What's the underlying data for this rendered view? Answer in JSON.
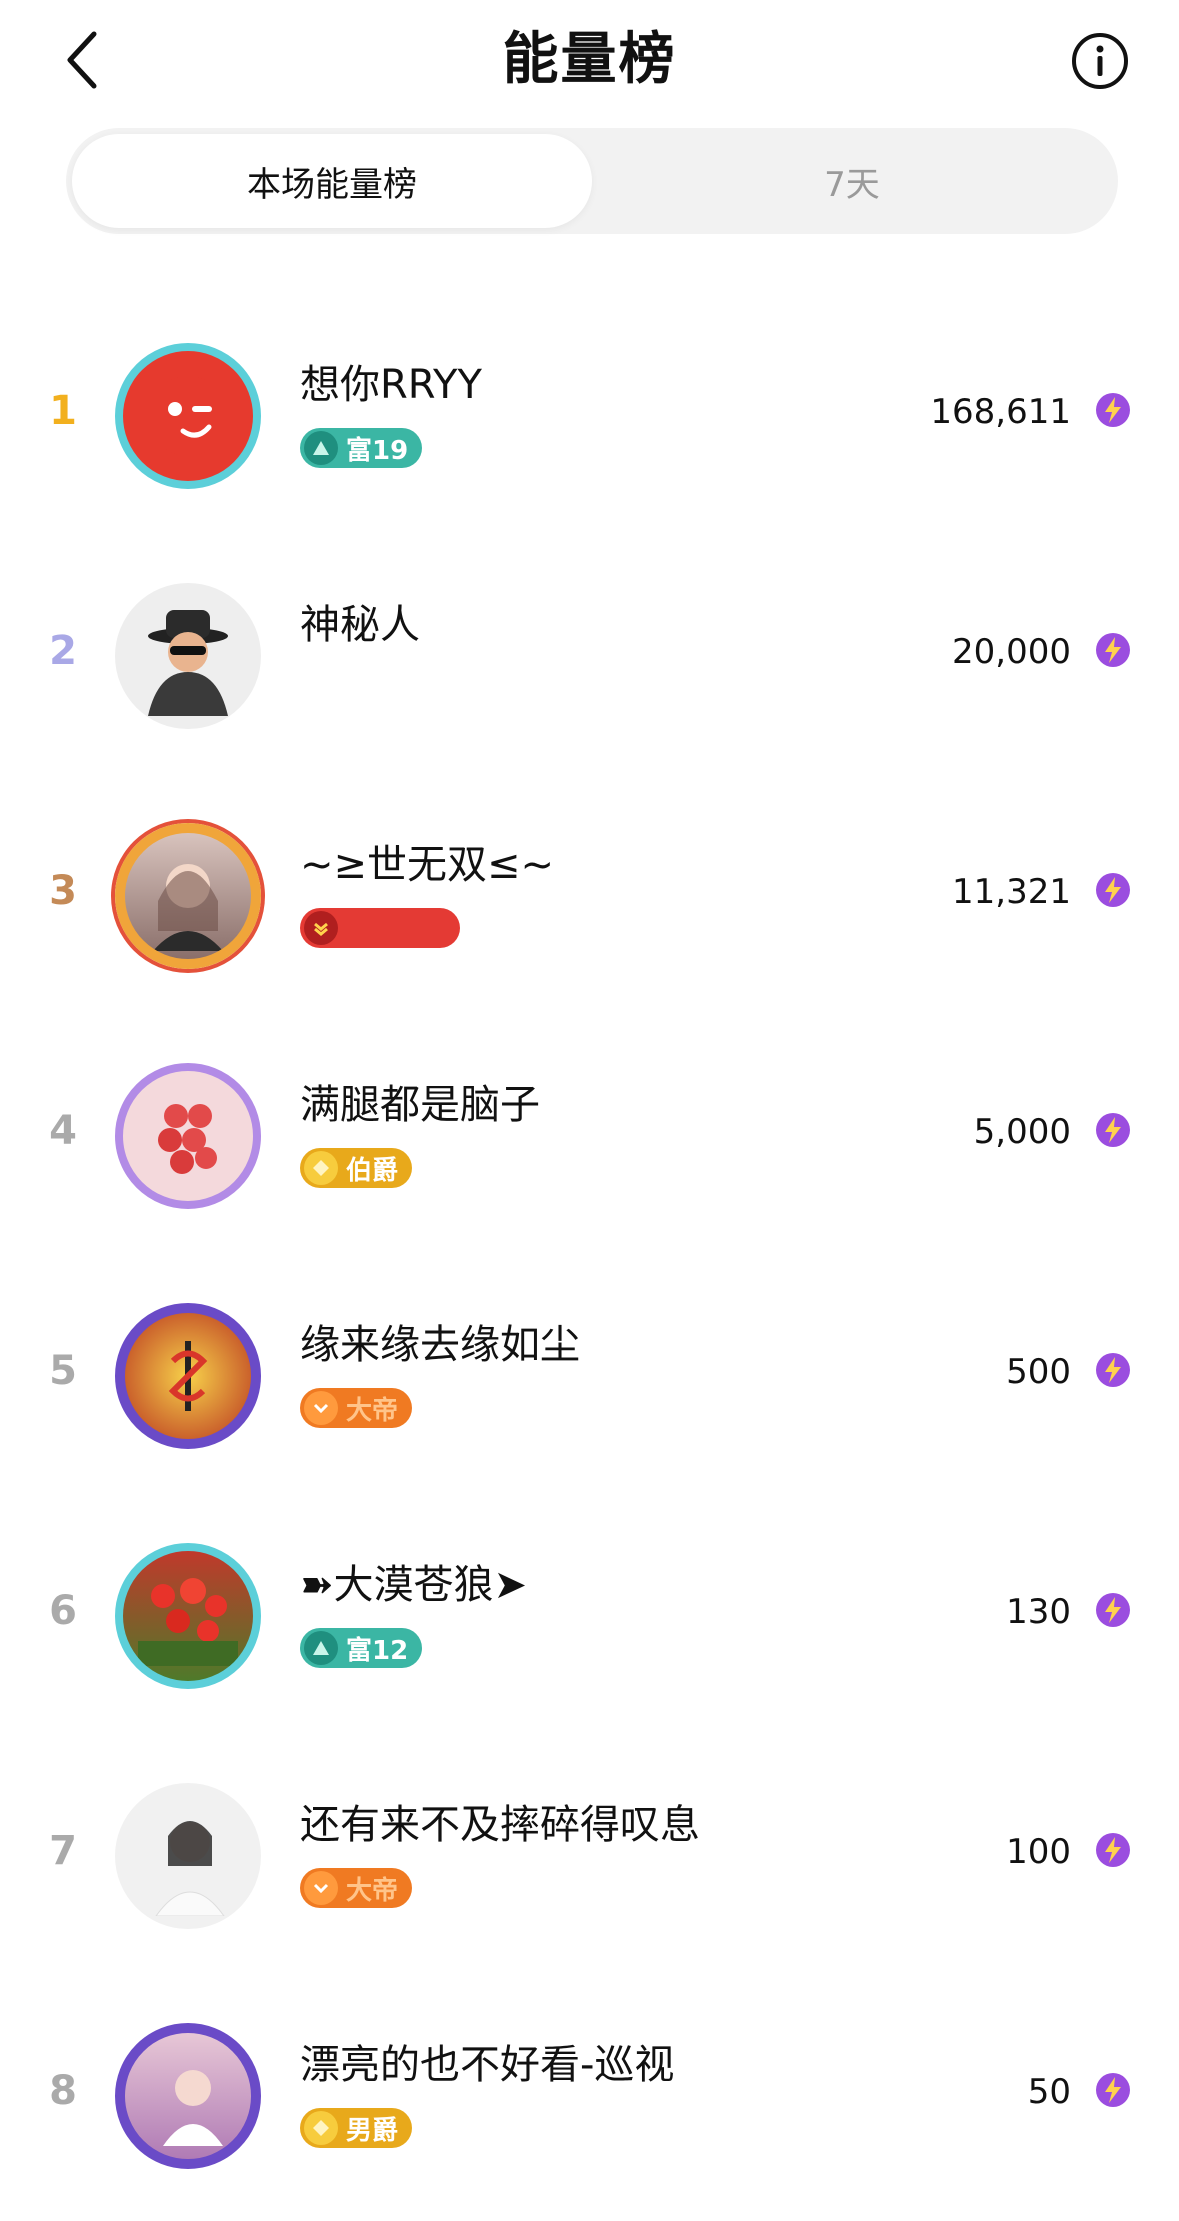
{
  "header": {
    "title": "能量榜",
    "back_icon": "chevron-left-icon",
    "info_icon": "info-icon"
  },
  "tabs": [
    {
      "label": "本场能量榜",
      "active": true
    },
    {
      "label": "7天",
      "active": false
    }
  ],
  "rank_colors": {
    "1": "#f2b01e",
    "2": "#a9a8e6",
    "3": "#c48a57",
    "other": "#aaaaaa"
  },
  "energy_icon": "lightning-icon",
  "rows": [
    {
      "rank": "1",
      "name": "想你RRYY",
      "badge": "富19",
      "badge_color": "#3bb6a4",
      "score": "168,611"
    },
    {
      "rank": "2",
      "name": "神秘人",
      "badge": "",
      "score": "20,000"
    },
    {
      "rank": "3",
      "name": "~≥世无双≤~",
      "badge": "",
      "badge_color": "#e43a34",
      "score": "11,321"
    },
    {
      "rank": "4",
      "name": "满腿都是脑子",
      "badge": "伯爵",
      "badge_color": "#e8a91b",
      "score": "5,000"
    },
    {
      "rank": "5",
      "name": "缘来缘去缘如尘",
      "badge": "大帝",
      "badge_color": "#f07a22",
      "score": "500"
    },
    {
      "rank": "6",
      "name": "➽大漠苍狼➤",
      "badge": "富12",
      "badge_color": "#3bb6a4",
      "score": "130"
    },
    {
      "rank": "7",
      "name": "还有来不及摔碎得叹息",
      "badge": "大帝",
      "badge_color": "#f07a22",
      "score": "100"
    },
    {
      "rank": "8",
      "name": "漂亮的也不好看-巡视",
      "badge": "男爵",
      "badge_color": "#e8a91b",
      "score": "50"
    }
  ]
}
